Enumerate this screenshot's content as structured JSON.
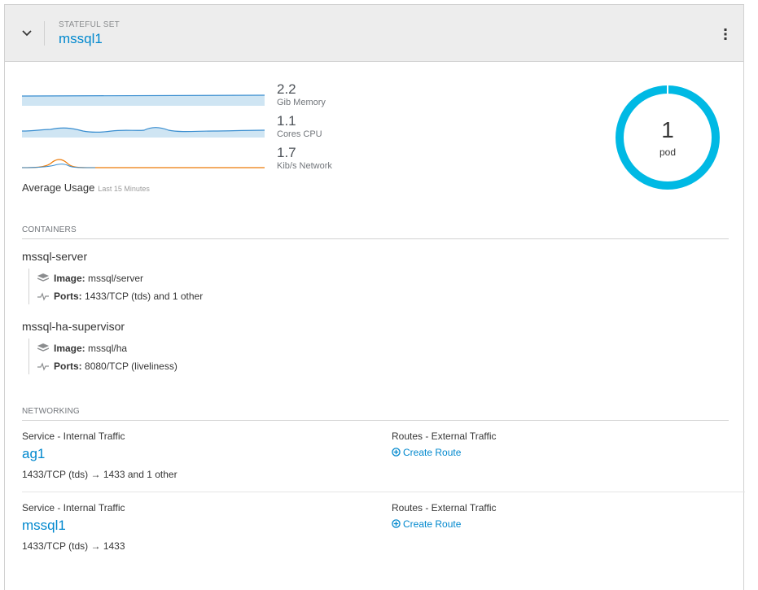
{
  "header": {
    "kind": "STATEFUL SET",
    "name": "mssql1"
  },
  "metrics": [
    {
      "value": "2.2",
      "unit": "Gib Memory"
    },
    {
      "value": "1.1",
      "unit": "Cores CPU"
    },
    {
      "value": "1.7",
      "unit": "Kib/s Network"
    }
  ],
  "usage": {
    "label": "Average Usage",
    "period": "Last 15 Minutes"
  },
  "pods": {
    "count": "1",
    "label": "pod"
  },
  "containers": {
    "title": "CONTAINERS",
    "items": [
      {
        "name": "mssql-server",
        "image_label": "Image:",
        "image": "mssql/server",
        "ports_label": "Ports:",
        "ports": "1433/TCP (tds) and 1 other"
      },
      {
        "name": "mssql-ha-supervisor",
        "image_label": "Image:",
        "image": "mssql/ha",
        "ports_label": "Ports:",
        "ports": "8080/TCP (liveliness)"
      }
    ]
  },
  "networking": {
    "title": "NETWORKING",
    "services": [
      {
        "label": "Service - Internal Traffic",
        "name": "ag1",
        "ports": "1433/TCP (tds) → 1433 and 1 other",
        "routes_label": "Routes - External Traffic",
        "route_action": "Create Route"
      },
      {
        "label": "Service - Internal Traffic",
        "name": "mssql1",
        "ports": "1433/TCP (tds) → 1433",
        "routes_label": "Routes - External Traffic",
        "route_action": "Create Route"
      }
    ]
  },
  "colors": {
    "accent": "#0088ce",
    "donut": "#00b9e4",
    "network_orange": "#ec7a08"
  }
}
